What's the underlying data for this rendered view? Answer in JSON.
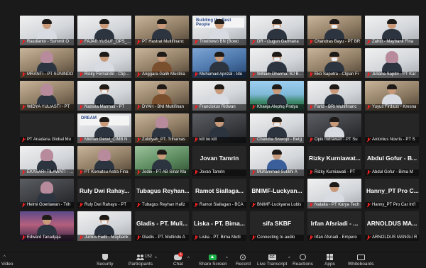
{
  "participants": [
    {
      "name": "Rasdianto - Summit O",
      "kind": "video",
      "tone": "t-white",
      "p": "light"
    },
    {
      "name": "FAJAR YUSUF_OPS_AS",
      "kind": "video",
      "tone": "t-white",
      "slide": "",
      "p": ""
    },
    {
      "name": "PT Hastrat Multifinanc",
      "kind": "video",
      "tone": "t-warm",
      "p": ""
    },
    {
      "name": "Triwibowo BN (Bowo",
      "kind": "video",
      "tone": "t-white",
      "slide": "Building the Best People",
      "p": "light"
    },
    {
      "name": "DR - Gugun Garmana",
      "kind": "video",
      "tone": "t-white",
      "p": "mask"
    },
    {
      "name": "Chandras Bayu - PT BR",
      "kind": "video",
      "tone": "t-warm",
      "p": "mask"
    },
    {
      "name": "Zahid - Maybank Fina",
      "kind": "video",
      "tone": "t-white",
      "p": ""
    },
    {
      "name": "MRANTI - PT SUNINDO",
      "kind": "video",
      "tone": "t-warm",
      "p": "hijab"
    },
    {
      "name": "Ricky Fernando - Clipan F",
      "kind": "video",
      "tone": "t-white",
      "p": "light"
    },
    {
      "name": "Anggara Galih Mustika",
      "kind": "video",
      "tone": "t-warm",
      "p": "batik"
    },
    {
      "name": "Muhamad Aprizal - Ide",
      "kind": "video",
      "tone": "t-blue",
      "p": ""
    },
    {
      "name": "William Dharma- BJ Bank",
      "kind": "video",
      "tone": "t-white",
      "p": "mask"
    },
    {
      "name": "Eko Saputra - Clipan Fi",
      "kind": "video",
      "tone": "t-warm",
      "p": "mask"
    },
    {
      "name": "Juliana Sapitri - PT Kar",
      "kind": "video",
      "tone": "t-white",
      "p": "hijab"
    },
    {
      "name": "WIDYA YULIASTI - PT",
      "kind": "video",
      "tone": "t-warm",
      "p": "hijab"
    },
    {
      "name": "Nassita Marmati - PT",
      "kind": "video",
      "tone": "t-white",
      "p": "mask"
    },
    {
      "name": "DYAH - BNI Multifinan",
      "kind": "video",
      "tone": "t-warm",
      "p": "batik"
    },
    {
      "name": "Franciskus Ridwan",
      "kind": "video",
      "tone": "t-white",
      "p": "light"
    },
    {
      "name": "Khaeja Alephq Pratya",
      "kind": "video",
      "tone": "t-sea",
      "p": ""
    },
    {
      "name": "Farid - BRI Multifinanc",
      "kind": "video",
      "tone": "t-white",
      "p": ""
    },
    {
      "name": "Yuyus Firdaus - Kresna",
      "kind": "video",
      "tone": "t-warm",
      "p": "light"
    },
    {
      "name": "PT Anadana Global Mu",
      "kind": "blank",
      "big": ""
    },
    {
      "name": "Mikhan Desvi_CIMB N",
      "kind": "video",
      "tone": "t-white",
      "slide": "DREAM",
      "p": ""
    },
    {
      "name": "Zulidyah_PT. Trihamas",
      "kind": "video",
      "tone": "t-warm",
      "p": "hijab"
    },
    {
      "name": "kill no kill",
      "kind": "video",
      "tone": "t-dark",
      "p": ""
    },
    {
      "name": "Chandra Siswojo - Betg",
      "kind": "video",
      "tone": "t-white",
      "p": "mask"
    },
    {
      "name": "Opik Indrawan - PT Su",
      "kind": "video",
      "tone": "t-dark",
      "p": "light"
    },
    {
      "name": "Antonius Novris - PT S",
      "kind": "blank",
      "big": ""
    },
    {
      "name": "EKASARI TILAWATI - PT",
      "kind": "video",
      "tone": "t-white",
      "p": "hijab"
    },
    {
      "name": "PT Komatsu Astra Fina",
      "kind": "video",
      "tone": "t-warm",
      "p": "hijab"
    },
    {
      "name": "Jodie - PT AB Sinar Ma",
      "kind": "video",
      "tone": "t-green",
      "p": ""
    },
    {
      "name": "Jovan Tamrin",
      "kind": "blank",
      "big": "Jovan Tamrin"
    },
    {
      "name": "Muhammad Sutikhi A",
      "kind": "video",
      "tone": "t-white",
      "p": "blue"
    },
    {
      "name": "Rizky Kurniawati - PT",
      "kind": "blank",
      "big": "Rizky Kurniawat..."
    },
    {
      "name": "Abdul Gofur - Bima M",
      "kind": "blank",
      "big": "Abdul Gofur - B..."
    },
    {
      "name": "Helmi Goeriawan - Trih",
      "kind": "video",
      "tone": "t-dark",
      "p": "hijab"
    },
    {
      "name": "Ruly Dwi Rahayu - PT",
      "kind": "blank",
      "big": "Ruly Dwi Rahay..."
    },
    {
      "name": "Tubagus Reyhan Hafiz",
      "kind": "blank",
      "big": "Tubagus Reyhan..."
    },
    {
      "name": "Ramot Siallagan - BCA",
      "kind": "blank",
      "big": "Ramot Siallaga..."
    },
    {
      "name": "BNIMF-Luckyana Lubis",
      "kind": "blank",
      "big": "BNIMF-Luckyan..."
    },
    {
      "name": "Natalia - PT Karya Tech",
      "kind": "video",
      "tone": "t-white",
      "p": "light"
    },
    {
      "name": "Hanny_PT Pro Car Int'l",
      "kind": "blank",
      "big": "Hanny_PT Pro C..."
    },
    {
      "name": "Edward Tanadjaja",
      "kind": "video",
      "tone": "t-city",
      "p": ""
    },
    {
      "name": "Junius Fadli - Maybank",
      "kind": "video",
      "tone": "t-white",
      "p": "mask"
    },
    {
      "name": "Gladis - PT. Multindo A",
      "kind": "blank",
      "big": "Gladis - PT. Muli..."
    },
    {
      "name": "Liska - PT. Bima Multi",
      "kind": "blank",
      "big": "Liska - PT. Bima..."
    },
    {
      "name": "Connecting to audio",
      "kind": "blank",
      "big": "sifa SKBF"
    },
    {
      "name": "Irfan Afsriadi - Empero",
      "kind": "blank",
      "big": "Irfan Afsriadi - ..."
    },
    {
      "name": "ARNOLDUS MANGU R",
      "kind": "blank",
      "big": "ARNOLDUS MA..."
    }
  ],
  "toolbar": {
    "video_label": "Video",
    "security_label": "Security",
    "participants_label": "Participants",
    "participants_count": "152",
    "chat_label": "Chat",
    "chat_badge": "1",
    "share_label": "Share Screen",
    "record_label": "Record",
    "transcript_label": "Live Transcript",
    "reactions_label": "Reactions",
    "apps_label": "Apps",
    "whiteboards_label": "Whiteboards"
  },
  "colors": {
    "share": "#1fb24a",
    "muted": "#e22222",
    "badge": "#e5322d"
  }
}
